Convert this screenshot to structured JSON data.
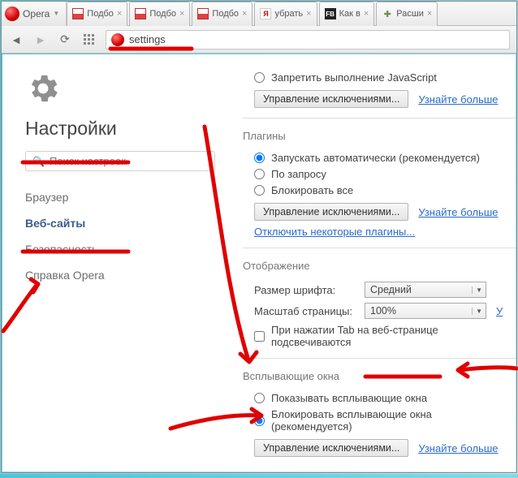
{
  "titlebar": {
    "menu_label": "Opera"
  },
  "tabs": [
    {
      "label": "Подбо",
      "favicon": "bars"
    },
    {
      "label": "Подбо",
      "favicon": "bars"
    },
    {
      "label": "Подбо",
      "favicon": "bars"
    },
    {
      "label": "убрать",
      "favicon": "y"
    },
    {
      "label": "Как в",
      "favicon": "fb"
    },
    {
      "label": "Расши",
      "favicon": "puzzle"
    }
  ],
  "address": {
    "value": "settings"
  },
  "sidebar": {
    "title": "Настройки",
    "search_placeholder": "Поиск настроек",
    "items": [
      {
        "label": "Браузер"
      },
      {
        "label": "Веб-сайты"
      },
      {
        "label": "Безопасность"
      },
      {
        "label": "Справка Opera"
      }
    ],
    "active_index": 1
  },
  "javascript": {
    "opt_deny": "Запретить выполнение JavaScript",
    "manage_btn": "Управление исключениями...",
    "learn_more": "Узнайте больше"
  },
  "plugins": {
    "title": "Плагины",
    "opt_auto": "Запускать автоматически (рекомендуется)",
    "opt_demand": "По запросу",
    "opt_block": "Блокировать все",
    "manage_btn": "Управление исключениями...",
    "learn_more": "Узнайте больше",
    "disable_link": "Отключить некоторые плагины..."
  },
  "display": {
    "title": "Отображение",
    "font_label": "Размер шрифта:",
    "font_value": "Средний",
    "zoom_label": "Масштаб страницы:",
    "zoom_value": "100%",
    "zoom_learn": "У",
    "tab_highlight": "При нажатии Tab на веб-странице подсвечиваются"
  },
  "popups": {
    "title": "Всплывающие окна",
    "opt_show": "Показывать всплывающие окна",
    "opt_block": "Блокировать всплывающие окна (рекомендуется)",
    "manage_btn": "Управление исключениями...",
    "learn_more": "Узнайте больше"
  }
}
